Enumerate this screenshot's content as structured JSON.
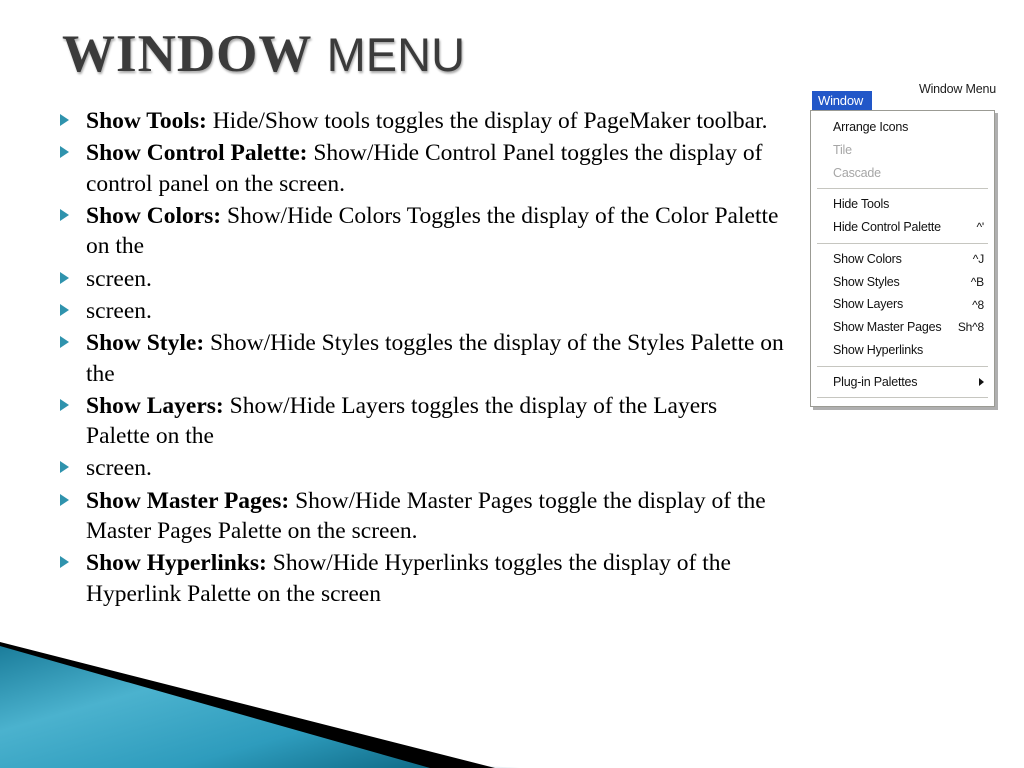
{
  "slide": {
    "title_part1": "WINDOW",
    "title_part2": "MENU",
    "accent_teal": "#2f93ad",
    "title_color": "#3b3b3b",
    "deco_teal_light": "#45a9c6",
    "deco_teal_dark": "#14748f",
    "deco_pale_blue": "#d4e2ea",
    "deco_black": "#000000"
  },
  "bullets": [
    {
      "lead": "Show Tools:",
      "rest": " Hide/Show tools toggles the display of PageMaker toolbar."
    },
    {
      "lead": "Show Control Palette:",
      "rest": " Show/Hide Control Panel toggles the display of  control panel on the screen."
    },
    {
      "lead": "Show Colors:",
      "rest": " Show/Hide Colors Toggles the display of the Color Palette on the"
    },
    {
      "lead": "",
      "rest": "screen."
    },
    {
      "lead": "",
      "rest": "screen."
    },
    {
      "lead": "Show Style:",
      "rest": " Show/Hide Styles toggles the display of the Styles Palette on the"
    },
    {
      "lead": "Show Layers:",
      "rest": " Show/Hide Layers toggles the display of the Layers Palette on the"
    },
    {
      "lead": "",
      "rest": "screen."
    },
    {
      "lead": " Show Master Pages:",
      "rest": " Show/Hide Master Pages toggle the display of the Master Pages Palette on the screen."
    },
    {
      "lead": " Show Hyperlinks:",
      "rest": " Show/Hide Hyperlinks toggles the display of the Hyperlink Palette on the screen"
    }
  ],
  "menu_shot": {
    "caption": "Window Menu",
    "menu_bar_label": "Window",
    "items": [
      {
        "label": "Arrange Icons",
        "accel": "",
        "disabled": false,
        "submenu": false
      },
      {
        "label": "Tile",
        "accel": "",
        "disabled": true,
        "submenu": false
      },
      {
        "label": "Cascade",
        "accel": "",
        "disabled": true,
        "submenu": false
      },
      {
        "separator": true
      },
      {
        "label": "Hide Tools",
        "accel": "",
        "disabled": false,
        "submenu": false
      },
      {
        "label": "Hide Control Palette",
        "accel": "^'",
        "disabled": false,
        "submenu": false
      },
      {
        "separator": true
      },
      {
        "label": "Show Colors",
        "accel": "^J",
        "disabled": false,
        "submenu": false
      },
      {
        "label": "Show Styles",
        "accel": "^B",
        "disabled": false,
        "submenu": false
      },
      {
        "label": "Show Layers",
        "accel": "^8",
        "disabled": false,
        "submenu": false
      },
      {
        "label": "Show Master Pages",
        "accel": "Sh^8",
        "disabled": false,
        "submenu": false
      },
      {
        "label": "Show Hyperlinks",
        "accel": "",
        "disabled": false,
        "submenu": false
      },
      {
        "separator": true
      },
      {
        "label": "Plug-in Palettes",
        "accel": "",
        "disabled": false,
        "submenu": true
      },
      {
        "separator": true
      }
    ]
  }
}
